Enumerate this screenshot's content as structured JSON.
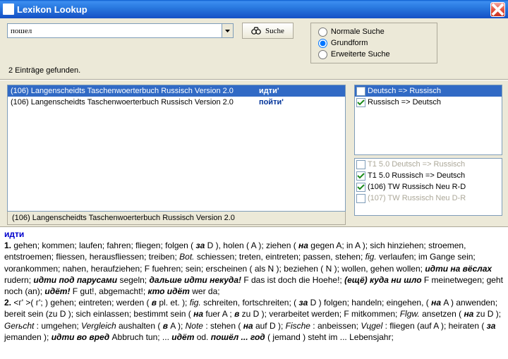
{
  "window": {
    "title": "Lexikon Lookup"
  },
  "search": {
    "query": "пошел",
    "button_label": "Suche",
    "status": "2 Einträge gefunden."
  },
  "modes": {
    "normal": "Normale Suche",
    "grund": "Grundform",
    "erw": "Erweiterte Suche"
  },
  "results": {
    "items": [
      {
        "source": "(106) Langenscheidts Taschenwoerterbuch Russisch Version 2.0",
        "word": "идти'"
      },
      {
        "source": "(106) Langenscheidts Taschenwoerterbuch Russisch Version 2.0",
        "word": "пойти'"
      }
    ],
    "footer": "(106) Langenscheidts Taschenwoerterbuch Russisch Version 2.0"
  },
  "dict_pairs": {
    "top": [
      {
        "label": "Deutsch => Russisch",
        "checked": false,
        "selected": true
      },
      {
        "label": "Russisch => Deutsch",
        "checked": true,
        "selected": false
      }
    ],
    "bottom": [
      {
        "label": "T1 5.0   Deutsch => Russisch",
        "checked": false,
        "disabled": true
      },
      {
        "label": "T1 5.0   Russisch => Deutsch",
        "checked": true,
        "disabled": false
      },
      {
        "label": "(106) TW Russisch Neu R-D",
        "checked": true,
        "disabled": false
      },
      {
        "label": "(107) TW Russisch Neu D-R",
        "checked": false,
        "disabled": true
      }
    ]
  },
  "def": {
    "headword": "идти",
    "line1a": "1. ",
    "line1b": "gehen; kommen; laufen; fahren; fliegen; folgen ( ",
    "za1": "за",
    "line1c": " D ), holen ( A ); ziehen ( ",
    "na1": "на",
    "line1d": " gegen A; in A ); sich hinziehen; stroemen, entstroemen; fliessen, herausfliessen; treiben; ",
    "bot": "Bot.",
    "line1e": " schiessen; treten, eintreten; passen, stehen; ",
    "fig1": "fig.",
    "line1f": " verlaufen; im Gange sein; vorankommen; nahen, heraufziehen; F fuehren; sein; erscheinen ( als N ); beziehen ( N ); wollen, gehen wollen; ",
    "r1": "идти на вёслах",
    "line1g": " rudern; ",
    "r2": "идти под парусами",
    "line1h": " segeln; ",
    "r3": "дальше идти некуда!",
    "line1i": " F das ist doch die Hoehe!; ",
    "r4": "(ещё) куда ни шло",
    "line1j": " F meinetwegen; geht noch (an); ",
    "r5": "идёт!",
    "line1k": " F gut!, abgemacht!; ",
    "r6": "кто идёт",
    "line1l": " wer da;",
    "line2a": " 2. ",
    "gram": "<г' >( г'; )",
    "line2b": " gehen; eintreten; werden ( ",
    "v1": "в",
    "line2c": " pl. et. ); ",
    "fig2": "fig.",
    "line2d": " schreiten, fortschreiten; ( ",
    "za2": "за",
    "line2e": " D ) folgen; handeln; eingehen, ( ",
    "na2": "на",
    "line2f": " A ) anwenden; bereit sein (zu D ); sich einlassen; bestimmt sein ( ",
    "na3": "на",
    "line2g": " fuer A ; ",
    "v2": "в",
    "line2h": " zu D ); verarbeitet werden; F mitkommen; ",
    "flgw": "Flgw.",
    "line2i": " ansetzen ( ",
    "na4": "на",
    "line2j": " zu D ); ",
    "ger": "Gerьcht",
    "line2k": " : umgehen; ",
    "vgl": "Vergleich",
    "line2l": " aushalten ( ",
    "v3": "в",
    "line2m": " A ); ",
    "note": "Note",
    "line2n": " : stehen ( ",
    "na5": "на",
    "line2o": " auf D ); ",
    "fische": "Fische",
    "line2p": " : anbeissen; ",
    "vugel": "Vцgel",
    "line2q": " : fliegen (auf A ); heiraten ( ",
    "za3": "за",
    "line2r": " jemanden ); ",
    "r7": "идти во вред",
    "line2s": " Abbruch tun; ... ",
    "r8": "идёт",
    "line2t": " od. ",
    "r9": "пошёл ... год",
    "line2u": " ( jemand ) steht im ... Lebensjahr;"
  }
}
